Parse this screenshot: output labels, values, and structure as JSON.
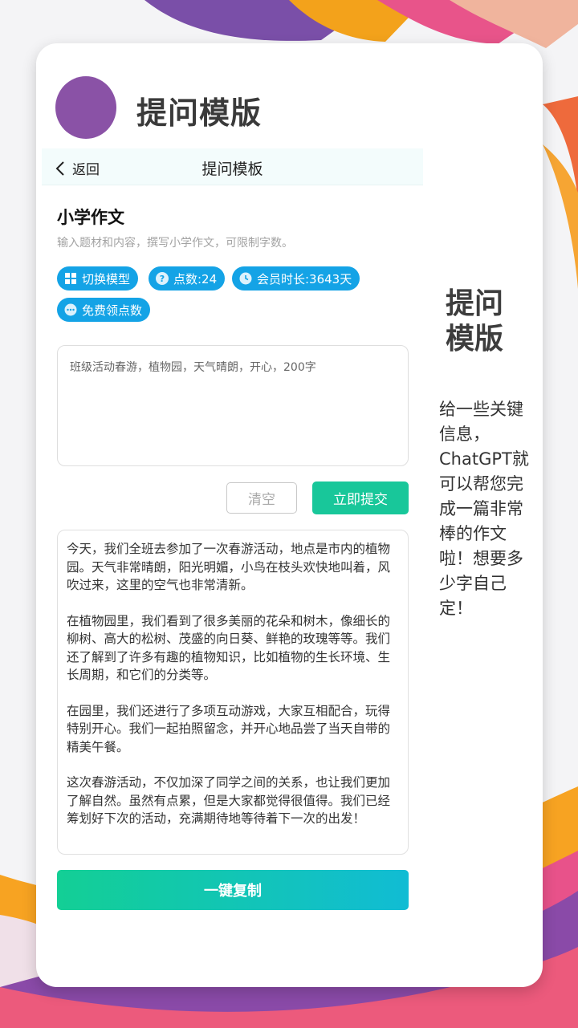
{
  "brand": {
    "title": "提问模版"
  },
  "nav": {
    "back_label": "返回",
    "title": "提问模板"
  },
  "template": {
    "title": "小学作文",
    "description": "输入题材和内容，撰写小学作文，可限制字数。"
  },
  "tags": {
    "switch_model": "切换模型",
    "points": "点数:24",
    "membership": "会员时长:3643天",
    "free_points": "免费领点数"
  },
  "input": {
    "value": "班级活动春游，植物园，天气晴朗，开心，200字"
  },
  "buttons": {
    "clear": "清空",
    "submit": "立即提交",
    "copy": "一键复制"
  },
  "result": {
    "paragraphs": [
      "今天，我们全班去参加了一次春游活动，地点是市内的植物园。天气非常晴朗，阳光明媚，小鸟在枝头欢快地叫着，风吹过来，这里的空气也非常清新。",
      "在植物园里，我们看到了很多美丽的花朵和树木，像细长的柳树、高大的松树、茂盛的向日葵、鲜艳的玫瑰等等。我们还了解到了许多有趣的植物知识，比如植物的生长环境、生长周期，和它们的分类等。",
      "在园里，我们还进行了多项互动游戏，大家互相配合，玩得特别开心。我们一起拍照留念，并开心地品尝了当天自带的精美午餐。",
      "这次春游活动，不仅加深了同学之间的关系，也让我们更加了解自然。虽然有点累，但是大家都觉得很值得。我们已经筹划好下次的活动，充满期待地等待着下一次的出发！"
    ]
  },
  "side": {
    "title": "提问模版",
    "description": "给一些关键信息，ChatGPT就可以帮您完成一篇非常棒的作文啦！想要多少字自己定！"
  },
  "colors": {
    "tag_blue": "#14a3e6",
    "submit_green": "#18c79a",
    "avatar_purple": "#8a52a6"
  }
}
